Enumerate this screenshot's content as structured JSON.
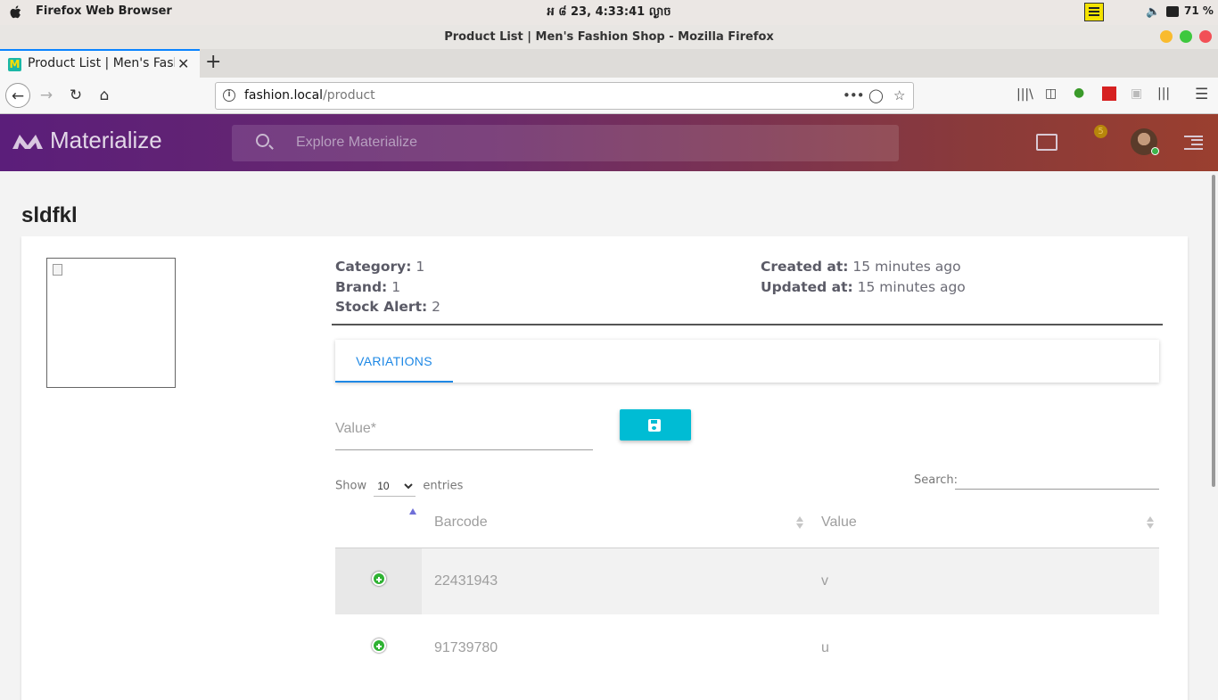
{
  "os": {
    "app_name": "Firefox Web Browser",
    "clock": "អ ៨ 23,  4:33:41 ល្ងាច",
    "battery": "71 %"
  },
  "browser": {
    "window_title": "Product List | Men's Fashion Shop - Mozilla Firefox",
    "tab_title": "Product List | Men's Fashion Shop",
    "url_host": "fashion.local",
    "url_path": "/product",
    "colors": {
      "close": "#f25056",
      "minimize": "#f9bb2e",
      "maximize": "#3ec83e"
    }
  },
  "app": {
    "logo_text": "Materialize",
    "search_placeholder": "Explore Materialize",
    "notification_count": "5"
  },
  "page": {
    "title": "sldfkl",
    "meta": {
      "category_label": "Category:",
      "category_value": "1",
      "brand_label": "Brand:",
      "brand_value": "1",
      "stock_alert_label": "Stock Alert:",
      "stock_alert_value": "2",
      "created_label": "Created at:",
      "created_value": "15 minutes ago",
      "updated_label": "Updated at:",
      "updated_value": "15 minutes ago"
    },
    "tab_label": "VARIATIONS",
    "value_placeholder": "Value*",
    "table": {
      "show_label": "Show",
      "entries_label": "entries",
      "page_length": "10",
      "search_label": "Search:",
      "columns": [
        "",
        "Barcode",
        "Value"
      ],
      "rows": [
        {
          "barcode": "22431943",
          "value": "v"
        },
        {
          "barcode": "91739780",
          "value": "u"
        }
      ]
    }
  }
}
